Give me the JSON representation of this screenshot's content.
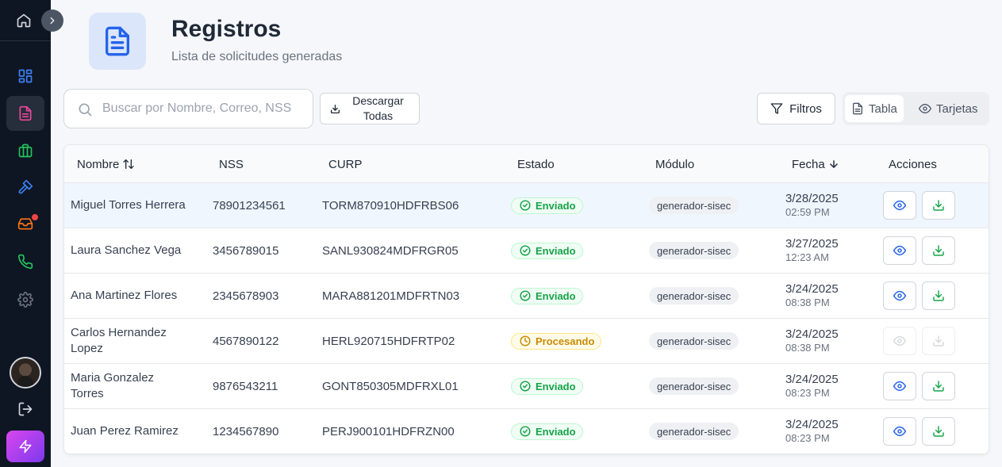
{
  "header": {
    "title": "Registros",
    "subtitle": "Lista de solicitudes generadas"
  },
  "toolbar": {
    "search_placeholder": "Buscar por Nombre, Correo, NSS",
    "download_all_label": "Descargar Todas",
    "filters_label": "Filtros",
    "view_table_label": "Tabla",
    "view_cards_label": "Tarjetas"
  },
  "table": {
    "columns": [
      "Nombre",
      "NSS",
      "CURP",
      "Estado",
      "Módulo",
      "Fecha",
      "Acciones"
    ],
    "rows": [
      {
        "name": "Miguel Torres Herrera",
        "nss": "78901234561",
        "curp": "TORM870910HDFRBS06",
        "status": "Enviado",
        "module": "generador-sisec",
        "date": "3/28/2025",
        "time": "02:59 PM"
      },
      {
        "name": "Laura Sanchez Vega",
        "nss": "3456789015",
        "curp": "SANL930824MDFRGR05",
        "status": "Enviado",
        "module": "generador-sisec",
        "date": "3/27/2025",
        "time": "12:23 AM"
      },
      {
        "name": "Ana Martinez Flores",
        "nss": "2345678903",
        "curp": "MARA881201MDFRTN03",
        "status": "Enviado",
        "module": "generador-sisec",
        "date": "3/24/2025",
        "time": "08:38 PM"
      },
      {
        "name": "Carlos Hernandez Lopez",
        "nss": "4567890122",
        "curp": "HERL920715HDFRTP02",
        "status": "Procesando",
        "module": "generador-sisec",
        "date": "3/24/2025",
        "time": "08:38 PM"
      },
      {
        "name": "Maria Gonzalez Torres",
        "nss": "9876543211",
        "curp": "GONT850305MDFRXL01",
        "status": "Enviado",
        "module": "generador-sisec",
        "date": "3/24/2025",
        "time": "08:23 PM"
      },
      {
        "name": "Juan Perez Ramirez",
        "nss": "1234567890",
        "curp": "PERJ900101HDFRZN00",
        "status": "Enviado",
        "module": "generador-sisec",
        "date": "3/24/2025",
        "time": "08:23 PM"
      }
    ]
  },
  "colors": {
    "sidebar_bg": "#0f1623",
    "accent_blue": "#2563eb",
    "status_sent": "#16a34a",
    "status_processing": "#ca8a04",
    "badge_red": "#ef4444"
  }
}
